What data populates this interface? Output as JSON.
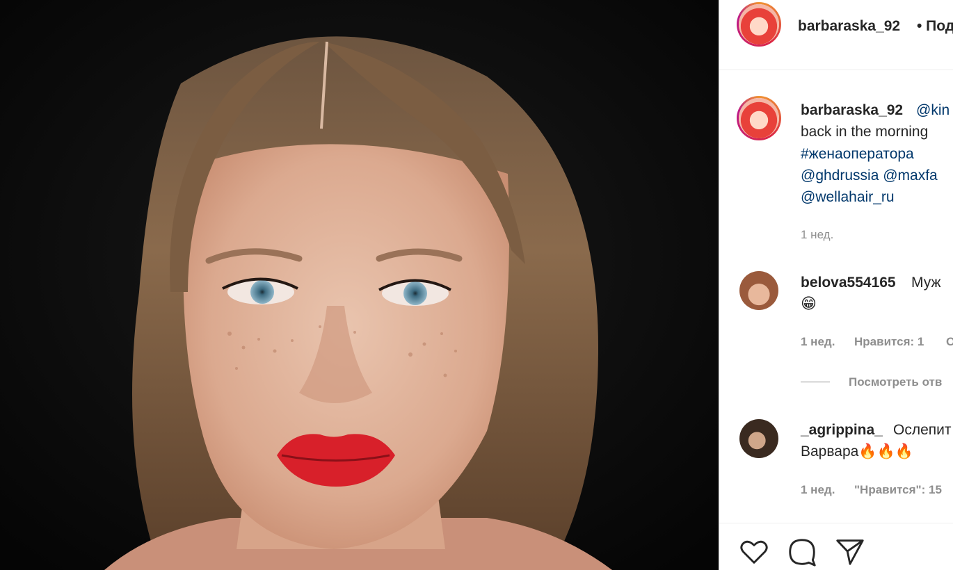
{
  "post": {
    "author": "barbaraska_92",
    "follow_label": "• Под",
    "caption": {
      "mention_1": "@kin",
      "line_2": "back in the morning",
      "hashtag": "#женаоператора",
      "mentions_line": "@ghdrussia @maxfa",
      "mention_last": "@wellahair_ru",
      "time": "1 нед."
    },
    "comments": [
      {
        "username": "belova554165",
        "text": "Муж",
        "emoji": "😁",
        "time": "1 нед.",
        "likes": "Нравится: 1",
        "reply_short": "О",
        "view_replies": "Посмотреть отв"
      },
      {
        "username": "_agrippina_",
        "text": "Ослепит",
        "text_line2": "Варвара🔥🔥🔥",
        "time": "1 нед.",
        "likes": "\"Нравится\": 15"
      }
    ]
  },
  "actions": {
    "like": "heart-icon",
    "comment": "comment-icon",
    "share": "share-icon"
  },
  "colors": {
    "link": "#00376b",
    "meta": "#8e8e8e",
    "lips": "#d8202a"
  }
}
